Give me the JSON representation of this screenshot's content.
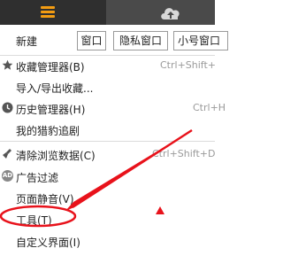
{
  "toolbar": {
    "menu_icon": "hamburger-menu-icon",
    "cloud_icon": "cloud-upload-icon"
  },
  "new_row": {
    "label": "新建",
    "window_btn": "窗口",
    "private_btn": "隐私窗口",
    "small_btn": "小号窗口"
  },
  "menu": {
    "bookmarks_manager": {
      "label": "收藏管理器(B)",
      "shortcut": "Ctrl+Shift+"
    },
    "import_export": {
      "label": "导入/导出收藏..."
    },
    "history_manager": {
      "label": "历史管理器(H)",
      "shortcut": "Ctrl+H"
    },
    "my_hunt": {
      "label": "我的猎豹追剧"
    },
    "clear_data": {
      "label": "清除浏览数据(C)",
      "shortcut": "Ctrl+Shift+D"
    },
    "ad_filter": {
      "label": "广告过滤",
      "icon_text": "AD"
    },
    "mute_page": {
      "label": "页面静音(V)"
    },
    "tools": {
      "label": "工具(T)"
    },
    "custom_ui": {
      "label": "自定义界面(I)"
    }
  },
  "colors": {
    "accent_orange": "#f39c12",
    "annotation_red": "#e8121b",
    "toolbar_dark": "#2f2f2f"
  }
}
